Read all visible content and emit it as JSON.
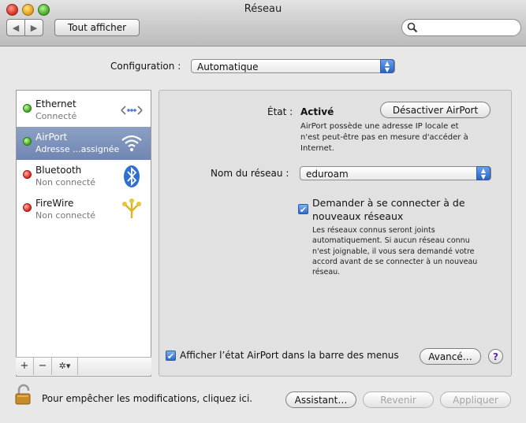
{
  "window": {
    "title": "Réseau"
  },
  "toolbar": {
    "back": "◀",
    "forward": "▶",
    "show_all": "Tout afficher",
    "search_value": ""
  },
  "config": {
    "label": "Configuration :",
    "value": "Automatique"
  },
  "services": [
    {
      "name": "Ethernet",
      "status": "Connecté",
      "status_color": "green",
      "icon": "ethernet-icon"
    },
    {
      "name": "AirPort",
      "status": "Adresse ...assignée",
      "status_color": "green",
      "icon": "wifi-icon",
      "selected": true
    },
    {
      "name": "Bluetooth",
      "status": "Non connecté",
      "status_color": "red",
      "icon": "bluetooth-icon"
    },
    {
      "name": "FireWire",
      "status": "Non connecté",
      "status_color": "red",
      "icon": "firewire-icon"
    }
  ],
  "list_footer": {
    "add": "+",
    "remove": "−",
    "gear": "✲▾"
  },
  "detail": {
    "state_label": "État :",
    "state_value": "Activé",
    "toggle_button": "Désactiver AirPort",
    "state_desc_l1": "AirPort possède une adresse IP locale et",
    "state_desc_l2": "n'est peut-être pas en mesure d'accéder à",
    "state_desc_l3": "Internet.",
    "network_label": "Nom du réseau :",
    "network_value": "eduroam",
    "ask_join_l1": "Demander à se connecter à de",
    "ask_join_l2": "nouveaux réseaux",
    "ask_desc_l1": "Les réseaux connus seront joints",
    "ask_desc_l2": "automatiquement. Si aucun réseau connu",
    "ask_desc_l3": "n'est joignable, il vous sera demandé votre",
    "ask_desc_l4": "accord avant de se connecter à un nouveau",
    "ask_desc_l5": "réseau.",
    "show_status": "Afficher l’état AirPort dans la barre des menus",
    "advanced": "Avancé…",
    "help": "?"
  },
  "footer": {
    "lock_text": "Pour empêcher les modifications, cliquez ici.",
    "assistant": "Assistant…",
    "revert": "Revenir",
    "apply": "Appliquer"
  }
}
